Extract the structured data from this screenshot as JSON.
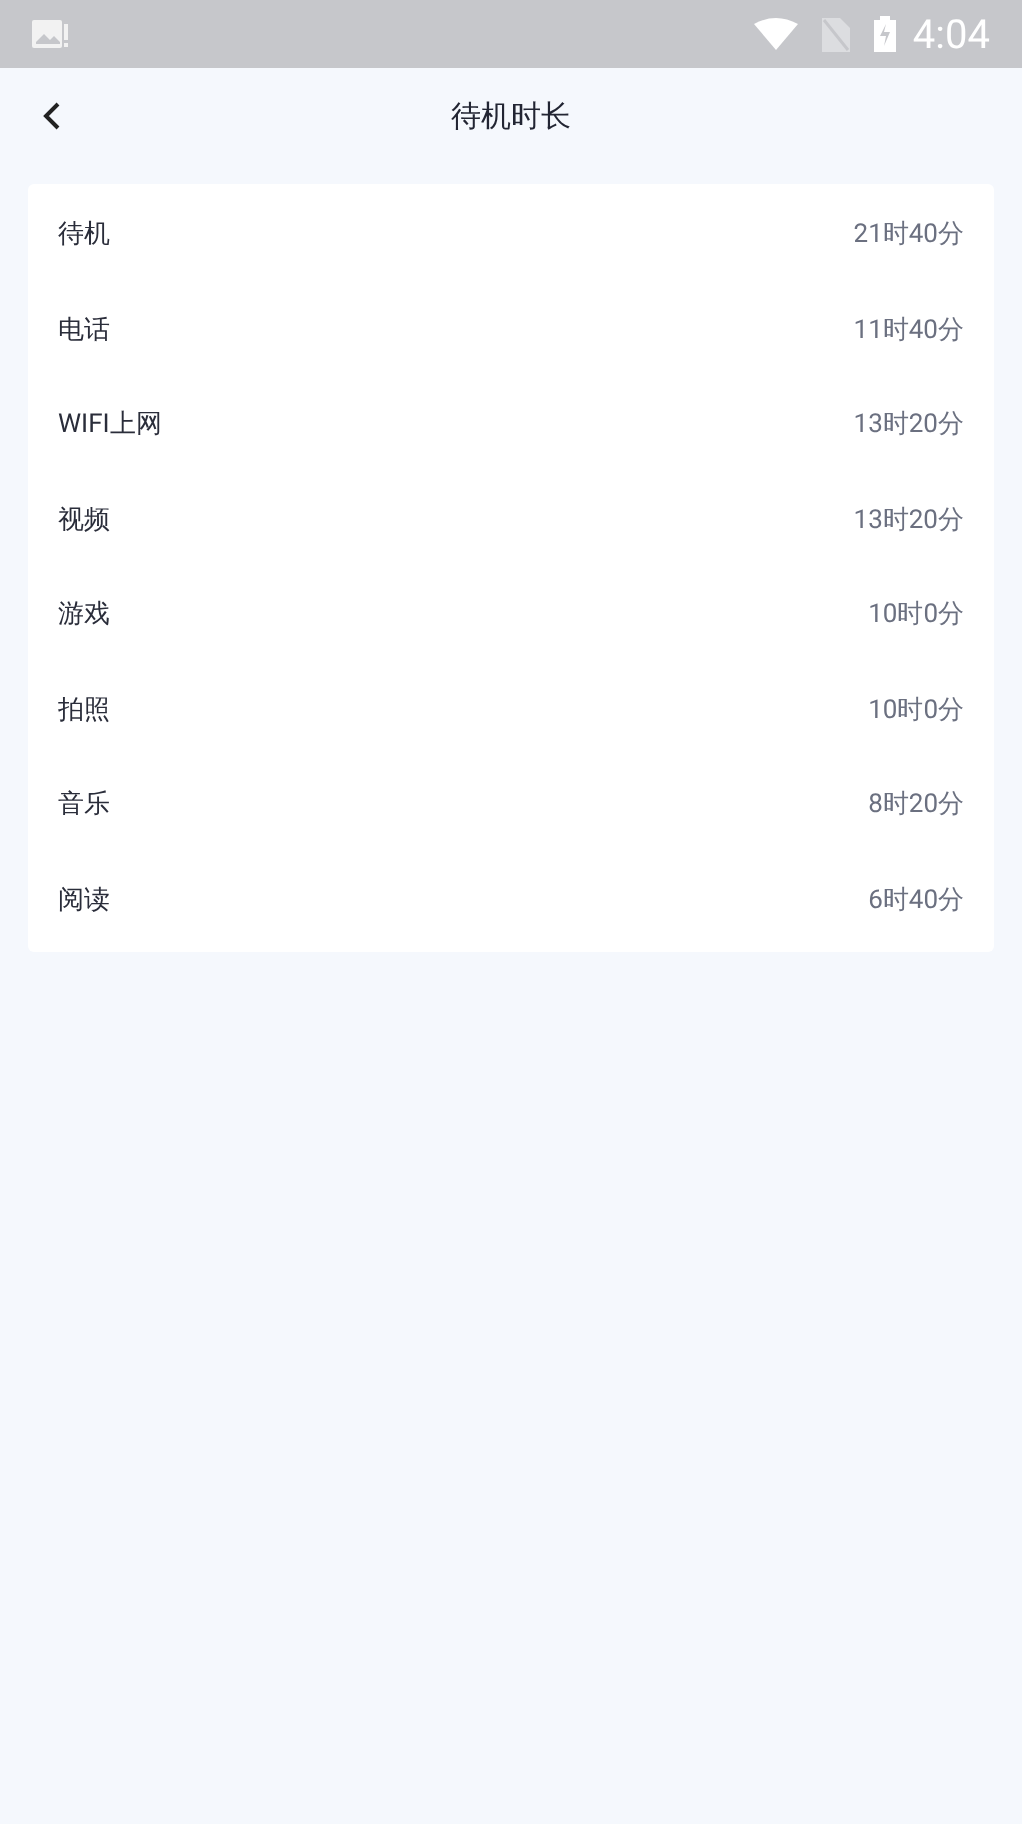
{
  "status_bar": {
    "time": "4:04"
  },
  "header": {
    "title": "待机时长"
  },
  "items": [
    {
      "label": "待机",
      "value": "21时40分"
    },
    {
      "label": "电话",
      "value": "11时40分"
    },
    {
      "label": "WIFI上网",
      "value": "13时20分"
    },
    {
      "label": "视频",
      "value": "13时20分"
    },
    {
      "label": "游戏",
      "value": "10时0分"
    },
    {
      "label": "拍照",
      "value": "10时0分"
    },
    {
      "label": "音乐",
      "value": "8时20分"
    },
    {
      "label": "阅读",
      "value": "6时40分"
    }
  ]
}
